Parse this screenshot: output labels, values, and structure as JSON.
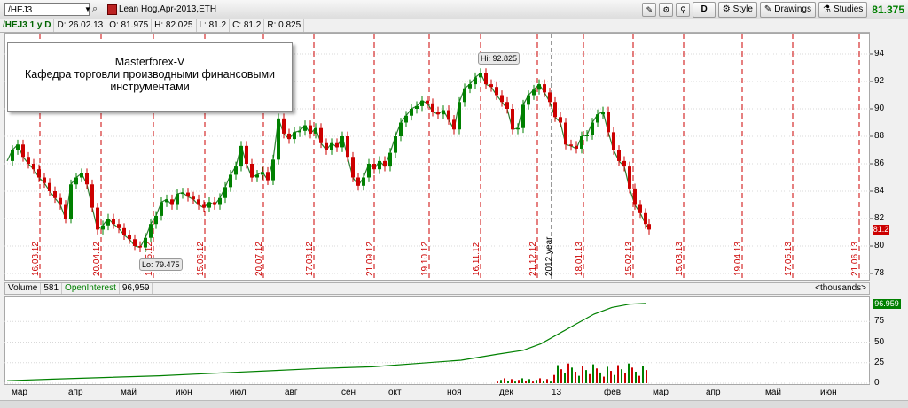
{
  "toolbar": {
    "symbol": "/HEJ3",
    "description": "Lean Hog,Apr-2013,ETH",
    "d_label": "D",
    "style_label": "Style",
    "drawings_label": "Drawings",
    "studies_label": "Studies",
    "last_price": "81.375"
  },
  "infobar": {
    "symbol_period": "/HEJ3 1 y D",
    "date": "D: 26.02.13",
    "open": "O: 81.975",
    "high": "H: 82.025",
    "low": "L: 81.2",
    "close": "C: 81.2",
    "range": "R: 0.825"
  },
  "annotation": {
    "line1": "Masterforex-V",
    "line2": "Кафедра торговли производными финансовыми",
    "line3": "инструментами"
  },
  "hi_label": "Hi: 92.825",
  "lo_label": "Lo: 79.475",
  "year_label": "2012 year",
  "price_axis": {
    "ticks": [
      "94",
      "92",
      "90",
      "88",
      "86",
      "84",
      "82",
      "80",
      "78"
    ],
    "last_tag": "81.2",
    "last_tag_color": "#cc0000"
  },
  "volume_bar": {
    "volume_label": "Volume",
    "volume_value": "581",
    "oi_label": "OpenInterest",
    "oi_value": "96,959",
    "units": "<thousands>"
  },
  "volume_axis": {
    "ticks": [
      "75",
      "50",
      "25",
      "0"
    ],
    "oi_tag": "96.959",
    "oi_tag_color": "#008000"
  },
  "time_axis": [
    "мар",
    "апр",
    "май",
    "июн",
    "июл",
    "авг",
    "сен",
    "окт",
    "ноя",
    "дек",
    "13",
    "фев",
    "мар",
    "апр",
    "май",
    "июн"
  ],
  "date_markers": [
    "16.03.12",
    "20.04.12",
    "18.05.12",
    "15.06.12",
    "20.07.12",
    "17.08.12",
    "21.09.12",
    "19.10.12",
    "16.11.12",
    "21.12.12",
    "18.01.13",
    "15.02.13",
    "15.03.13",
    "19.04.13",
    "17.05.13",
    "21.06.13"
  ],
  "chart_data": {
    "type": "candlestick",
    "price_range": [
      78,
      95
    ],
    "high": 92.825,
    "low": 79.475,
    "last": 81.2,
    "open_interest_last": 96.959,
    "volume_range": [
      0,
      100
    ]
  },
  "colors": {
    "up": "#008000",
    "down": "#cc0000",
    "marker": "#cc0000",
    "oi_line": "#008000"
  }
}
